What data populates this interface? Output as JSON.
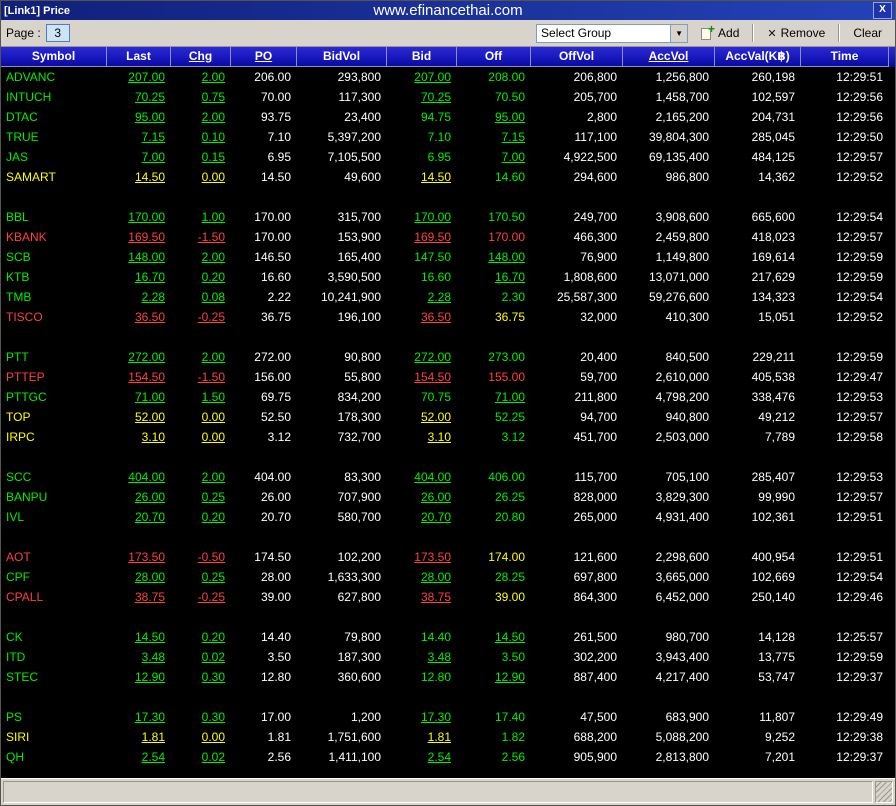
{
  "window": {
    "title": "[Link1] Price",
    "watermark": "www.efinancethai.com",
    "close_label": "X"
  },
  "toolbar": {
    "page_label": "Page :",
    "page_value": "3",
    "group_value": "Select Group",
    "add_label": "Add",
    "remove_label": "Remove",
    "clear_label": "Clear"
  },
  "colors": {
    "up": "#00f000",
    "down": "#ff4040",
    "flat": "#ffff00",
    "neutral": "#ffffff"
  },
  "table": {
    "columns": [
      {
        "label": "Symbol",
        "u": false
      },
      {
        "label": "Last",
        "u": false
      },
      {
        "label": "Chg",
        "u": true
      },
      {
        "label": "PO",
        "u": true
      },
      {
        "label": "BidVol",
        "u": false
      },
      {
        "label": "Bid",
        "u": false
      },
      {
        "label": "Off",
        "u": false
      },
      {
        "label": "OffVol",
        "u": false
      },
      {
        "label": "AccVol",
        "u": true
      },
      {
        "label": "AccVal(K฿)",
        "u": false
      },
      {
        "label": "Time",
        "u": false
      }
    ],
    "rows": [
      {
        "symbol": "ADVANC",
        "trend": "up",
        "last": "207.00",
        "chg": "2.00",
        "po": "206.00",
        "bidvol": "293,800",
        "bid": "207.00",
        "bid_c": "up",
        "bid_u": true,
        "off": "208.00",
        "off_c": "up",
        "off_u": false,
        "offvol": "206,800",
        "accvol": "1,256,800",
        "accval": "260,198",
        "time": "12:29:51"
      },
      {
        "symbol": "INTUCH",
        "trend": "up",
        "last": "70.25",
        "chg": "0.75",
        "po": "70.00",
        "bidvol": "117,300",
        "bid": "70.25",
        "bid_c": "up",
        "bid_u": true,
        "off": "70.50",
        "off_c": "up",
        "off_u": false,
        "offvol": "205,700",
        "accvol": "1,458,700",
        "accval": "102,597",
        "time": "12:29:56"
      },
      {
        "symbol": "DTAC",
        "trend": "up",
        "last": "95.00",
        "chg": "2.00",
        "po": "93.75",
        "bidvol": "23,400",
        "bid": "94.75",
        "bid_c": "up",
        "bid_u": false,
        "off": "95.00",
        "off_c": "up",
        "off_u": true,
        "offvol": "2,800",
        "accvol": "2,165,200",
        "accval": "204,731",
        "time": "12:29:56"
      },
      {
        "symbol": "TRUE",
        "trend": "up",
        "last": "7.15",
        "chg": "0.10",
        "po": "7.10",
        "bidvol": "5,397,200",
        "bid": "7.10",
        "bid_c": "up",
        "bid_u": false,
        "off": "7.15",
        "off_c": "up",
        "off_u": true,
        "offvol": "117,100",
        "accvol": "39,804,300",
        "accval": "285,045",
        "time": "12:29:50"
      },
      {
        "symbol": "JAS",
        "trend": "up",
        "last": "7.00",
        "chg": "0.15",
        "po": "6.95",
        "bidvol": "7,105,500",
        "bid": "6.95",
        "bid_c": "up",
        "bid_u": false,
        "off": "7.00",
        "off_c": "up",
        "off_u": true,
        "offvol": "4,922,500",
        "accvol": "69,135,400",
        "accval": "484,125",
        "time": "12:29:57"
      },
      {
        "symbol": "SAMART",
        "trend": "flat",
        "last": "14.50",
        "chg": "0.00",
        "po": "14.50",
        "bidvol": "49,600",
        "bid": "14.50",
        "bid_c": "flat",
        "bid_u": true,
        "off": "14.60",
        "off_c": "up",
        "off_u": false,
        "offvol": "294,600",
        "accvol": "986,800",
        "accval": "14,362",
        "time": "12:29:52"
      },
      {
        "spacer": true
      },
      {
        "symbol": "BBL",
        "trend": "up",
        "last": "170.00",
        "chg": "1.00",
        "po": "170.00",
        "bidvol": "315,700",
        "bid": "170.00",
        "bid_c": "up",
        "bid_u": true,
        "off": "170.50",
        "off_c": "up",
        "off_u": false,
        "offvol": "249,700",
        "accvol": "3,908,600",
        "accval": "665,600",
        "time": "12:29:54"
      },
      {
        "symbol": "KBANK",
        "trend": "down",
        "last": "169.50",
        "chg": "-1.50",
        "po": "170.00",
        "bidvol": "153,900",
        "bid": "169.50",
        "bid_c": "down",
        "bid_u": true,
        "off": "170.00",
        "off_c": "down",
        "off_u": false,
        "offvol": "466,300",
        "accvol": "2,459,800",
        "accval": "418,023",
        "time": "12:29:57"
      },
      {
        "symbol": "SCB",
        "trend": "up",
        "last": "148.00",
        "chg": "2.00",
        "po": "146.50",
        "bidvol": "165,400",
        "bid": "147.50",
        "bid_c": "up",
        "bid_u": false,
        "off": "148.00",
        "off_c": "up",
        "off_u": true,
        "offvol": "76,900",
        "accvol": "1,149,800",
        "accval": "169,614",
        "time": "12:29:59"
      },
      {
        "symbol": "KTB",
        "trend": "up",
        "last": "16.70",
        "chg": "0.20",
        "po": "16.60",
        "bidvol": "3,590,500",
        "bid": "16.60",
        "bid_c": "up",
        "bid_u": false,
        "off": "16.70",
        "off_c": "up",
        "off_u": true,
        "offvol": "1,808,600",
        "accvol": "13,071,000",
        "accval": "217,629",
        "time": "12:29:59"
      },
      {
        "symbol": "TMB",
        "trend": "up",
        "last": "2.28",
        "chg": "0.08",
        "po": "2.22",
        "bidvol": "10,241,900",
        "bid": "2.28",
        "bid_c": "up",
        "bid_u": true,
        "off": "2.30",
        "off_c": "up",
        "off_u": false,
        "offvol": "25,587,300",
        "accvol": "59,276,600",
        "accval": "134,323",
        "time": "12:29:54"
      },
      {
        "symbol": "TISCO",
        "trend": "down",
        "last": "36.50",
        "chg": "-0.25",
        "po": "36.75",
        "bidvol": "196,100",
        "bid": "36.50",
        "bid_c": "down",
        "bid_u": true,
        "off": "36.75",
        "off_c": "flat",
        "off_u": false,
        "offvol": "32,000",
        "accvol": "410,300",
        "accval": "15,051",
        "time": "12:29:52"
      },
      {
        "spacer": true
      },
      {
        "symbol": "PTT",
        "trend": "up",
        "last": "272.00",
        "chg": "2.00",
        "po": "272.00",
        "bidvol": "90,800",
        "bid": "272.00",
        "bid_c": "up",
        "bid_u": true,
        "off": "273.00",
        "off_c": "up",
        "off_u": false,
        "offvol": "20,400",
        "accvol": "840,500",
        "accval": "229,211",
        "time": "12:29:59"
      },
      {
        "symbol": "PTTEP",
        "trend": "down",
        "last": "154.50",
        "chg": "-1.50",
        "po": "156.00",
        "bidvol": "55,800",
        "bid": "154.50",
        "bid_c": "down",
        "bid_u": true,
        "off": "155.00",
        "off_c": "down",
        "off_u": false,
        "offvol": "59,700",
        "accvol": "2,610,000",
        "accval": "405,538",
        "time": "12:29:47"
      },
      {
        "symbol": "PTTGC",
        "trend": "up",
        "last": "71.00",
        "chg": "1.50",
        "po": "69.75",
        "bidvol": "834,200",
        "bid": "70.75",
        "bid_c": "up",
        "bid_u": false,
        "off": "71.00",
        "off_c": "up",
        "off_u": true,
        "offvol": "211,800",
        "accvol": "4,798,200",
        "accval": "338,476",
        "time": "12:29:53"
      },
      {
        "symbol": "TOP",
        "trend": "flat",
        "last": "52.00",
        "chg": "0.00",
        "po": "52.50",
        "bidvol": "178,300",
        "bid": "52.00",
        "bid_c": "flat",
        "bid_u": true,
        "off": "52.25",
        "off_c": "up",
        "off_u": false,
        "offvol": "94,700",
        "accvol": "940,800",
        "accval": "49,212",
        "time": "12:29:57"
      },
      {
        "symbol": "IRPC",
        "trend": "flat",
        "last": "3.10",
        "chg": "0.00",
        "po": "3.12",
        "bidvol": "732,700",
        "bid": "3.10",
        "bid_c": "flat",
        "bid_u": true,
        "off": "3.12",
        "off_c": "up",
        "off_u": false,
        "offvol": "451,700",
        "accvol": "2,503,000",
        "accval": "7,789",
        "time": "12:29:58"
      },
      {
        "spacer": true
      },
      {
        "symbol": "SCC",
        "trend": "up",
        "last": "404.00",
        "chg": "2.00",
        "po": "404.00",
        "bidvol": "83,300",
        "bid": "404.00",
        "bid_c": "up",
        "bid_u": true,
        "off": "406.00",
        "off_c": "up",
        "off_u": false,
        "offvol": "115,700",
        "accvol": "705,100",
        "accval": "285,407",
        "time": "12:29:53"
      },
      {
        "symbol": "BANPU",
        "trend": "up",
        "last": "26.00",
        "chg": "0.25",
        "po": "26.00",
        "bidvol": "707,900",
        "bid": "26.00",
        "bid_c": "up",
        "bid_u": true,
        "off": "26.25",
        "off_c": "up",
        "off_u": false,
        "offvol": "828,000",
        "accvol": "3,829,300",
        "accval": "99,990",
        "time": "12:29:57"
      },
      {
        "symbol": "IVL",
        "trend": "up",
        "last": "20.70",
        "chg": "0.20",
        "po": "20.70",
        "bidvol": "580,700",
        "bid": "20.70",
        "bid_c": "up",
        "bid_u": true,
        "off": "20.80",
        "off_c": "up",
        "off_u": false,
        "offvol": "265,000",
        "accvol": "4,931,400",
        "accval": "102,361",
        "time": "12:29:51"
      },
      {
        "spacer": true
      },
      {
        "symbol": "AOT",
        "trend": "down",
        "last": "173.50",
        "chg": "-0.50",
        "po": "174.50",
        "bidvol": "102,200",
        "bid": "173.50",
        "bid_c": "down",
        "bid_u": true,
        "off": "174.00",
        "off_c": "flat",
        "off_u": false,
        "offvol": "121,600",
        "accvol": "2,298,600",
        "accval": "400,954",
        "time": "12:29:51"
      },
      {
        "symbol": "CPF",
        "trend": "up",
        "last": "28.00",
        "chg": "0.25",
        "po": "28.00",
        "bidvol": "1,633,300",
        "bid": "28.00",
        "bid_c": "up",
        "bid_u": true,
        "off": "28.25",
        "off_c": "up",
        "off_u": false,
        "offvol": "697,800",
        "accvol": "3,665,000",
        "accval": "102,669",
        "time": "12:29:54"
      },
      {
        "symbol": "CPALL",
        "trend": "down",
        "last": "38.75",
        "chg": "-0.25",
        "po": "39.00",
        "bidvol": "627,800",
        "bid": "38.75",
        "bid_c": "down",
        "bid_u": true,
        "off": "39.00",
        "off_c": "flat",
        "off_u": false,
        "offvol": "864,300",
        "accvol": "6,452,000",
        "accval": "250,140",
        "time": "12:29:46"
      },
      {
        "spacer": true
      },
      {
        "symbol": "CK",
        "trend": "up",
        "last": "14.50",
        "chg": "0.20",
        "po": "14.40",
        "bidvol": "79,800",
        "bid": "14.40",
        "bid_c": "up",
        "bid_u": false,
        "off": "14.50",
        "off_c": "up",
        "off_u": true,
        "offvol": "261,500",
        "accvol": "980,700",
        "accval": "14,128",
        "time": "12:25:57"
      },
      {
        "symbol": "ITD",
        "trend": "up",
        "last": "3.48",
        "chg": "0.02",
        "po": "3.50",
        "bidvol": "187,300",
        "bid": "3.48",
        "bid_c": "up",
        "bid_u": true,
        "off": "3.50",
        "off_c": "up",
        "off_u": false,
        "offvol": "302,200",
        "accvol": "3,943,400",
        "accval": "13,775",
        "time": "12:29:59"
      },
      {
        "symbol": "STEC",
        "trend": "up",
        "last": "12.90",
        "chg": "0.30",
        "po": "12.80",
        "bidvol": "360,600",
        "bid": "12.80",
        "bid_c": "up",
        "bid_u": false,
        "off": "12.90",
        "off_c": "up",
        "off_u": true,
        "offvol": "887,400",
        "accvol": "4,217,400",
        "accval": "53,747",
        "time": "12:29:37"
      },
      {
        "spacer": true
      },
      {
        "symbol": "PS",
        "trend": "up",
        "last": "17.30",
        "chg": "0.30",
        "po": "17.00",
        "bidvol": "1,200",
        "bid": "17.30",
        "bid_c": "up",
        "bid_u": true,
        "off": "17.40",
        "off_c": "up",
        "off_u": false,
        "offvol": "47,500",
        "accvol": "683,900",
        "accval": "11,807",
        "time": "12:29:49"
      },
      {
        "symbol": "SIRI",
        "trend": "flat",
        "last": "1.81",
        "chg": "0.00",
        "po": "1.81",
        "bidvol": "1,751,600",
        "bid": "1.81",
        "bid_c": "flat",
        "bid_u": true,
        "off": "1.82",
        "off_c": "up",
        "off_u": false,
        "offvol": "688,200",
        "accvol": "5,088,200",
        "accval": "9,252",
        "time": "12:29:38"
      },
      {
        "symbol": "QH",
        "trend": "up",
        "last": "2.54",
        "chg": "0.02",
        "po": "2.56",
        "bidvol": "1,411,100",
        "bid": "2.54",
        "bid_c": "up",
        "bid_u": true,
        "off": "2.56",
        "off_c": "up",
        "off_u": false,
        "offvol": "905,900",
        "accvol": "2,813,800",
        "accval": "7,201",
        "time": "12:29:37"
      }
    ]
  }
}
